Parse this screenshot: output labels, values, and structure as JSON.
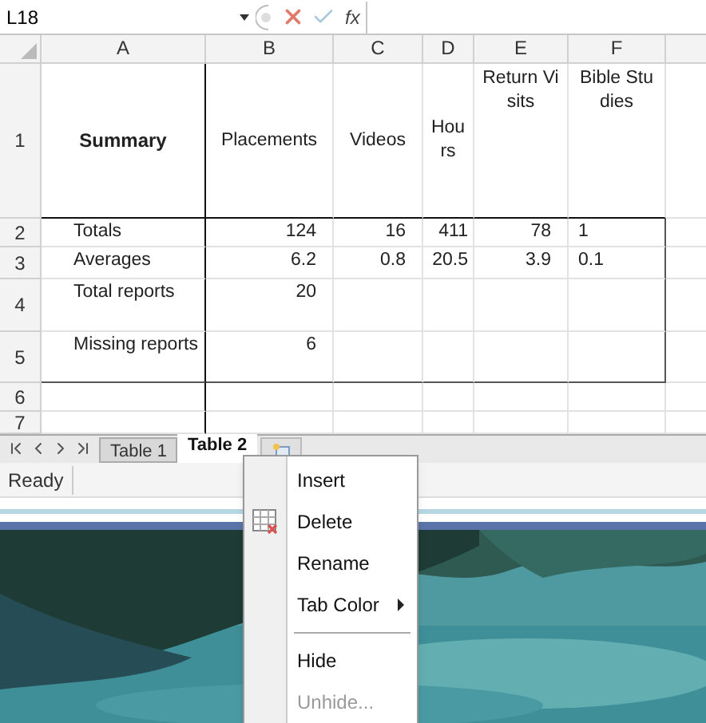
{
  "formula_bar": {
    "name_box": "L18",
    "function_label": "fx"
  },
  "columns": [
    "A",
    "B",
    "C",
    "D",
    "E",
    "F"
  ],
  "rows": [
    {
      "number": "1",
      "kind": "header",
      "cells": [
        "Summary",
        "Placements",
        "Videos",
        "Hours",
        "Return Visits",
        "Bible Studies"
      ]
    },
    {
      "number": "2",
      "kind": "data",
      "cells": [
        "Totals",
        "124",
        "16",
        "411",
        "78",
        "1"
      ]
    },
    {
      "number": "3",
      "kind": "data",
      "cells": [
        "Averages",
        "6.2",
        "0.8",
        "20.5",
        "3.9",
        "0.1"
      ]
    },
    {
      "number": "4",
      "kind": "data",
      "cells": [
        "Total reports",
        "20",
        "",
        "",
        "",
        ""
      ]
    },
    {
      "number": "5",
      "kind": "data",
      "cells": [
        "Missing reports",
        "6",
        "",
        "",
        "",
        ""
      ]
    },
    {
      "number": "6",
      "kind": "blank",
      "cells": []
    },
    {
      "number": "7",
      "kind": "blank",
      "cells": []
    }
  ],
  "sheet_tabs": [
    {
      "label": "Table 1",
      "selected": false
    },
    {
      "label": "Table 2",
      "selected": true
    }
  ],
  "status_bar": {
    "text": "Ready"
  },
  "context_menu": [
    {
      "kind": "item",
      "label": "Insert",
      "disabled": false
    },
    {
      "kind": "item",
      "label": "Delete",
      "disabled": false,
      "has_icon": true
    },
    {
      "kind": "item",
      "label": "Rename",
      "disabled": false
    },
    {
      "kind": "submenu",
      "label": "Tab Color",
      "disabled": false
    },
    {
      "kind": "separator"
    },
    {
      "kind": "item",
      "label": "Hide",
      "disabled": false
    },
    {
      "kind": "item",
      "label": "Unhide...",
      "disabled": true
    }
  ]
}
